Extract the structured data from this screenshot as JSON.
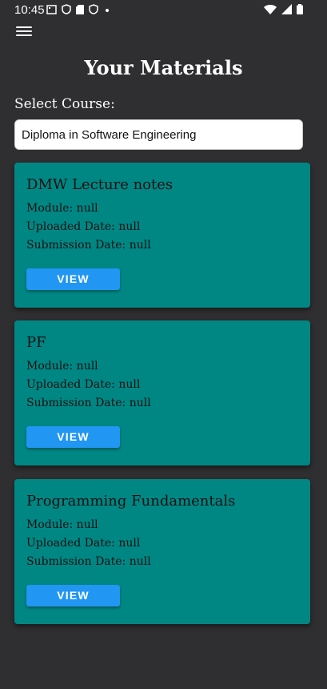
{
  "status_bar": {
    "time": "10:45",
    "left_icons": [
      "notification-icon",
      "shield-icon",
      "sd-card-icon",
      "shield-icon",
      "dot-icon"
    ],
    "right_icons": [
      "wifi-icon",
      "signal-icon",
      "battery-icon"
    ]
  },
  "header": {
    "title": "Your Materials"
  },
  "course": {
    "label": "Select Course:",
    "value": "Diploma in Software Engineering"
  },
  "materials": [
    {
      "title": "DMW Lecture notes",
      "module": "Module: null",
      "uploaded": "Uploaded Date: null",
      "submission": "Submission Date: null",
      "button": "VIEW"
    },
    {
      "title": "PF",
      "module": "Module: null",
      "uploaded": "Uploaded Date: null",
      "submission": "Submission Date: null",
      "button": "VIEW"
    },
    {
      "title": "Programming Fundamentals",
      "module": "Module: null",
      "uploaded": "Uploaded Date: null",
      "submission": "Submission Date: null",
      "button": "VIEW"
    }
  ],
  "colors": {
    "background": "#2f2e30",
    "card": "#008784",
    "button": "#2196f3"
  }
}
